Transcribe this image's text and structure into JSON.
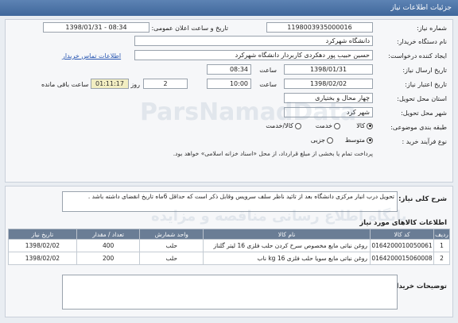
{
  "header": {
    "title": "جزئیات اطلاعات نیاز"
  },
  "form": {
    "need_number": {
      "label": "شماره نیاز:",
      "value": "1198003935000016"
    },
    "announce": {
      "label": "تاریخ و ساعت اعلان عمومی:",
      "value": "1398/01/31 - 08:34"
    },
    "buyer": {
      "label": "نام دستگاه خریدار:",
      "value": "دانشگاه شهرکرد"
    },
    "creator": {
      "label": "ایجاد کننده درخواست:",
      "value": "حسین حبیب پور دهکردی کاربردار دانشگاه شهرکرد",
      "contact_link": "اطلاعات تماس خریدار"
    },
    "send_date": {
      "label": "تاریخ ارسال نیاز:",
      "date": "1398/01/31",
      "time_label": "ساعت",
      "time": "08:34"
    },
    "deadline": {
      "label": "تاریخ اعتبار نیاز:",
      "date": "1398/02/02",
      "time_label": "ساعت",
      "time": "10:00",
      "days": "2",
      "days_label": "روز و",
      "remaining_time": "01:11:17",
      "remaining_label": "ساعت باقی مانده"
    },
    "province": {
      "label": "استان محل تحویل:",
      "value": "چهار محال و بختیاری"
    },
    "city": {
      "label": "شهر محل تحویل:",
      "value": "شهر کرد"
    },
    "category": {
      "label": "طبقه بندی موضوعی:",
      "options": [
        "کالا",
        "خدمت",
        "کالا/خدمت"
      ],
      "selected": "کالا"
    },
    "process": {
      "label": "نوع فرآیند خرید :",
      "options": [
        "متوسط",
        "جزیی"
      ],
      "selected": "متوسط"
    },
    "process_note": "پرداخت تمام یا بخشی از مبلغ قرارداد، از محل «اسناد خزانه اسلامی» خواهد بود."
  },
  "summary": {
    "label": "شرح کلی نیاز:",
    "value": "تحویل درب انبار مرکزی دانشگاه بعد از تائید ناظر سلف سرویس وقابل ذکر است که حداقل 6ماه تاریخ انقضای داشته باشد ."
  },
  "goods": {
    "title": "اطلاعات کالاهای مورد نیاز",
    "columns": [
      "ردیف",
      "کد کالا",
      "نام کالا",
      "واحد شمارش",
      "تعداد / مقدار",
      "تاریخ نیاز"
    ],
    "rows": [
      [
        "1",
        "0164200010050061",
        "روغن نباتی مایع مخصوص سرخ کردن حلب فلزی 16 لیتر گلناز",
        "حلب",
        "400",
        "1398/02/02"
      ],
      [
        "2",
        "0164200015060008",
        "روغن نباتی مایع سویا حلب فلزی 16 kg ناب",
        "حلب",
        "200",
        "1398/02/02"
      ]
    ]
  },
  "buyer_notes": {
    "label": "توضیحات خریدار:",
    "value": ""
  },
  "watermarks": [
    "ParsNamadData",
    "پایگاه اطلاع رسانی مناقصه و مزایده"
  ],
  "colors": {
    "header": "#4a72a6",
    "table_header": "#6a7d95",
    "timer_bg": "#f2eec2",
    "link": "#2a58b3"
  }
}
